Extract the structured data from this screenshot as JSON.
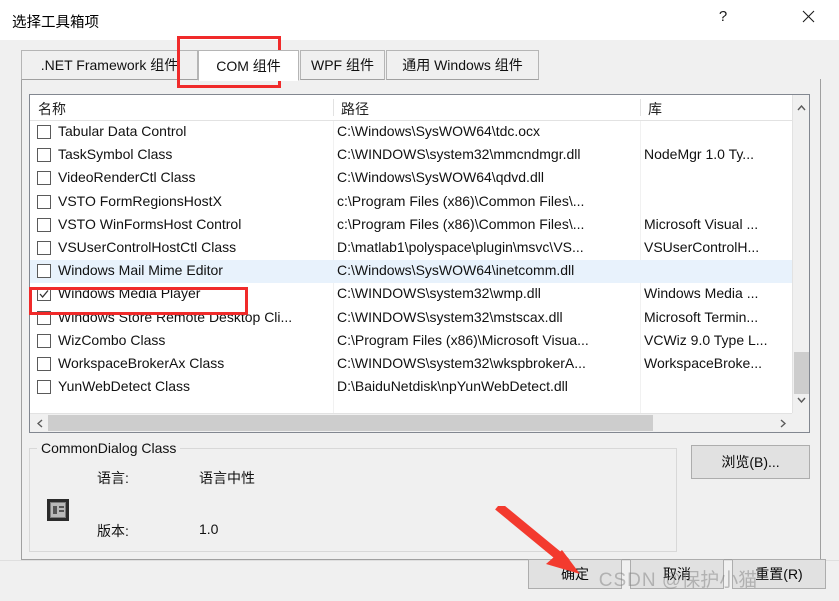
{
  "window": {
    "title": "选择工具箱项",
    "help_icon": "?",
    "close_icon": "close-icon"
  },
  "tabs": [
    {
      "id": "net",
      "label": ".NET Framework 组件",
      "active": false
    },
    {
      "id": "com",
      "label": "COM 组件",
      "active": true
    },
    {
      "id": "wpf",
      "label": "WPF 组件",
      "active": false
    },
    {
      "id": "uwp",
      "label": "通用 Windows 组件",
      "active": false
    }
  ],
  "list": {
    "columns": [
      {
        "key": "name",
        "label": "名称"
      },
      {
        "key": "path",
        "label": "路径"
      },
      {
        "key": "lib",
        "label": "库"
      }
    ],
    "rows": [
      {
        "name": "Tabular Data Control",
        "path": "C:\\Windows\\SysWOW64\\tdc.ocx",
        "lib": "",
        "checked": false,
        "selected": false
      },
      {
        "name": "TaskSymbol Class",
        "path": "C:\\WINDOWS\\system32\\mmcndmgr.dll",
        "lib": "NodeMgr 1.0 Ty...",
        "checked": false,
        "selected": false
      },
      {
        "name": "VideoRenderCtl Class",
        "path": "C:\\Windows\\SysWOW64\\qdvd.dll",
        "lib": "",
        "checked": false,
        "selected": false
      },
      {
        "name": "VSTO FormRegionsHostX",
        "path": "c:\\Program Files (x86)\\Common Files\\...",
        "lib": "",
        "checked": false,
        "selected": false
      },
      {
        "name": "VSTO WinFormsHost Control",
        "path": "c:\\Program Files (x86)\\Common Files\\...",
        "lib": "Microsoft Visual ...",
        "checked": false,
        "selected": false
      },
      {
        "name": "VSUserControlHostCtl Class",
        "path": "D:\\matlab1\\polyspace\\plugin\\msvc\\VS...",
        "lib": "VSUserControlH...",
        "checked": false,
        "selected": false
      },
      {
        "name": "Windows Mail Mime Editor",
        "path": "C:\\Windows\\SysWOW64\\inetcomm.dll",
        "lib": "",
        "checked": false,
        "selected": true
      },
      {
        "name": "Windows Media Player",
        "path": "C:\\WINDOWS\\system32\\wmp.dll",
        "lib": "Windows Media ...",
        "checked": true,
        "selected": false
      },
      {
        "name": "Windows Store Remote Desktop Cli...",
        "path": "C:\\WINDOWS\\system32\\mstscax.dll",
        "lib": "Microsoft Termin...",
        "checked": false,
        "selected": false
      },
      {
        "name": "WizCombo Class",
        "path": "C:\\Program Files (x86)\\Microsoft Visua...",
        "lib": "VCWiz 9.0 Type L...",
        "checked": false,
        "selected": false
      },
      {
        "name": "WorkspaceBrokerAx Class",
        "path": "C:\\WINDOWS\\system32\\wkspbrokerA...",
        "lib": "WorkspaceBroke...",
        "checked": false,
        "selected": false
      },
      {
        "name": "YunWebDetect Class",
        "path": "D:\\BaiduNetdisk\\npYunWebDetect.dll",
        "lib": "",
        "checked": false,
        "selected": false
      }
    ],
    "scroll_up_icon": "chevron-up-icon",
    "scroll_down_icon": "chevron-down-icon",
    "scroll_left_icon": "chevron-left-icon",
    "scroll_right_icon": "chevron-right-icon"
  },
  "browse_button": {
    "label": "浏览(B)..."
  },
  "details": {
    "title": "CommonDialog Class",
    "language_label": "语言:",
    "language_value": "语言中性",
    "version_label": "版本:",
    "version_value": "1.0",
    "icon": "com-component-icon"
  },
  "footer": {
    "ok_label": "确定",
    "cancel_label": "取消",
    "reset_label": "重置(R)"
  },
  "annotations": {
    "highlight_color": "#f02a2a",
    "arrow_color": "#f33a2e",
    "watermark_prefix": "CSDN",
    "watermark_text": "@保护小猫"
  }
}
